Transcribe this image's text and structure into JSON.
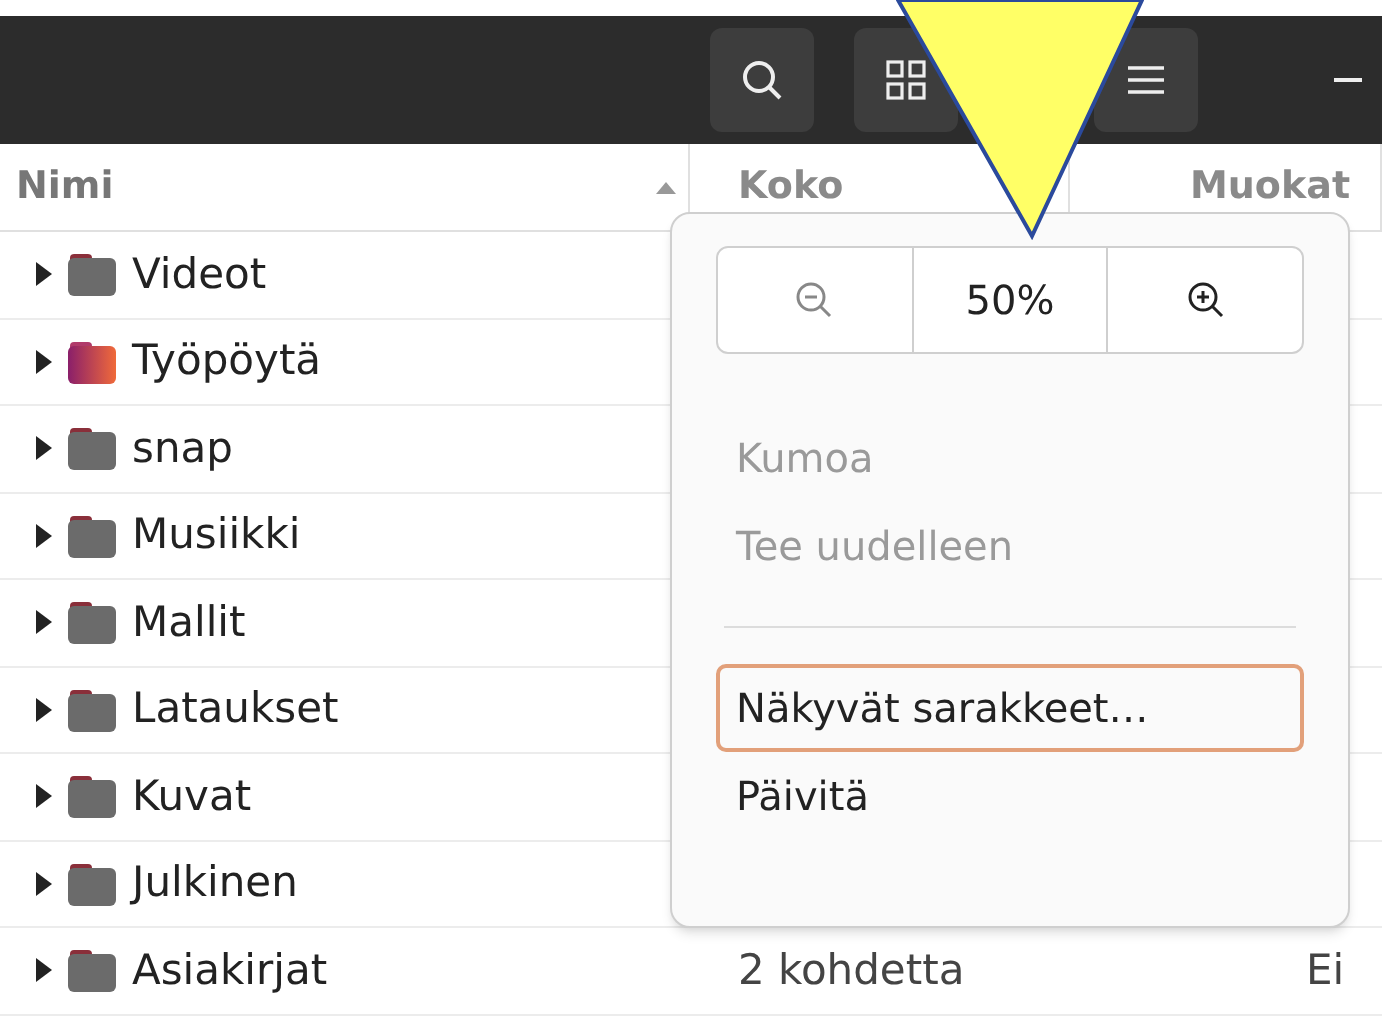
{
  "headerbar": {
    "buttons": [
      {
        "kind": "search"
      },
      {
        "kind": "grid"
      },
      {
        "kind": "menu"
      },
      {
        "kind": "minimize"
      }
    ]
  },
  "table": {
    "columns": [
      {
        "label": "Nimi",
        "sorted": true
      },
      {
        "label": "Koko",
        "sorted": false
      },
      {
        "label": "Muokat",
        "sorted": false
      }
    ],
    "rows": [
      {
        "name": "Videot",
        "kind": "folder"
      },
      {
        "name": "Työpöytä",
        "kind": "desktop"
      },
      {
        "name": "snap",
        "kind": "folder"
      },
      {
        "name": "Musiikki",
        "kind": "folder"
      },
      {
        "name": "Mallit",
        "kind": "folder"
      },
      {
        "name": "Lataukset",
        "kind": "folder"
      },
      {
        "name": "Kuvat",
        "kind": "folder"
      },
      {
        "name": "Julkinen",
        "kind": "folder"
      },
      {
        "name": "Asiakirjat",
        "kind": "folder",
        "size": "2 kohdetta",
        "modified": "Ei"
      }
    ]
  },
  "menu": {
    "zoom": "50%",
    "items": [
      {
        "label": "Kumoa",
        "disabled": true,
        "selected": false
      },
      {
        "label": "Tee uudelleen",
        "disabled": true,
        "selected": false
      },
      {
        "kind": "separator"
      },
      {
        "label": "Näkyvät sarakkeet…",
        "disabled": false,
        "selected": true
      },
      {
        "label": "Päivitä",
        "disabled": false,
        "selected": false
      }
    ]
  }
}
